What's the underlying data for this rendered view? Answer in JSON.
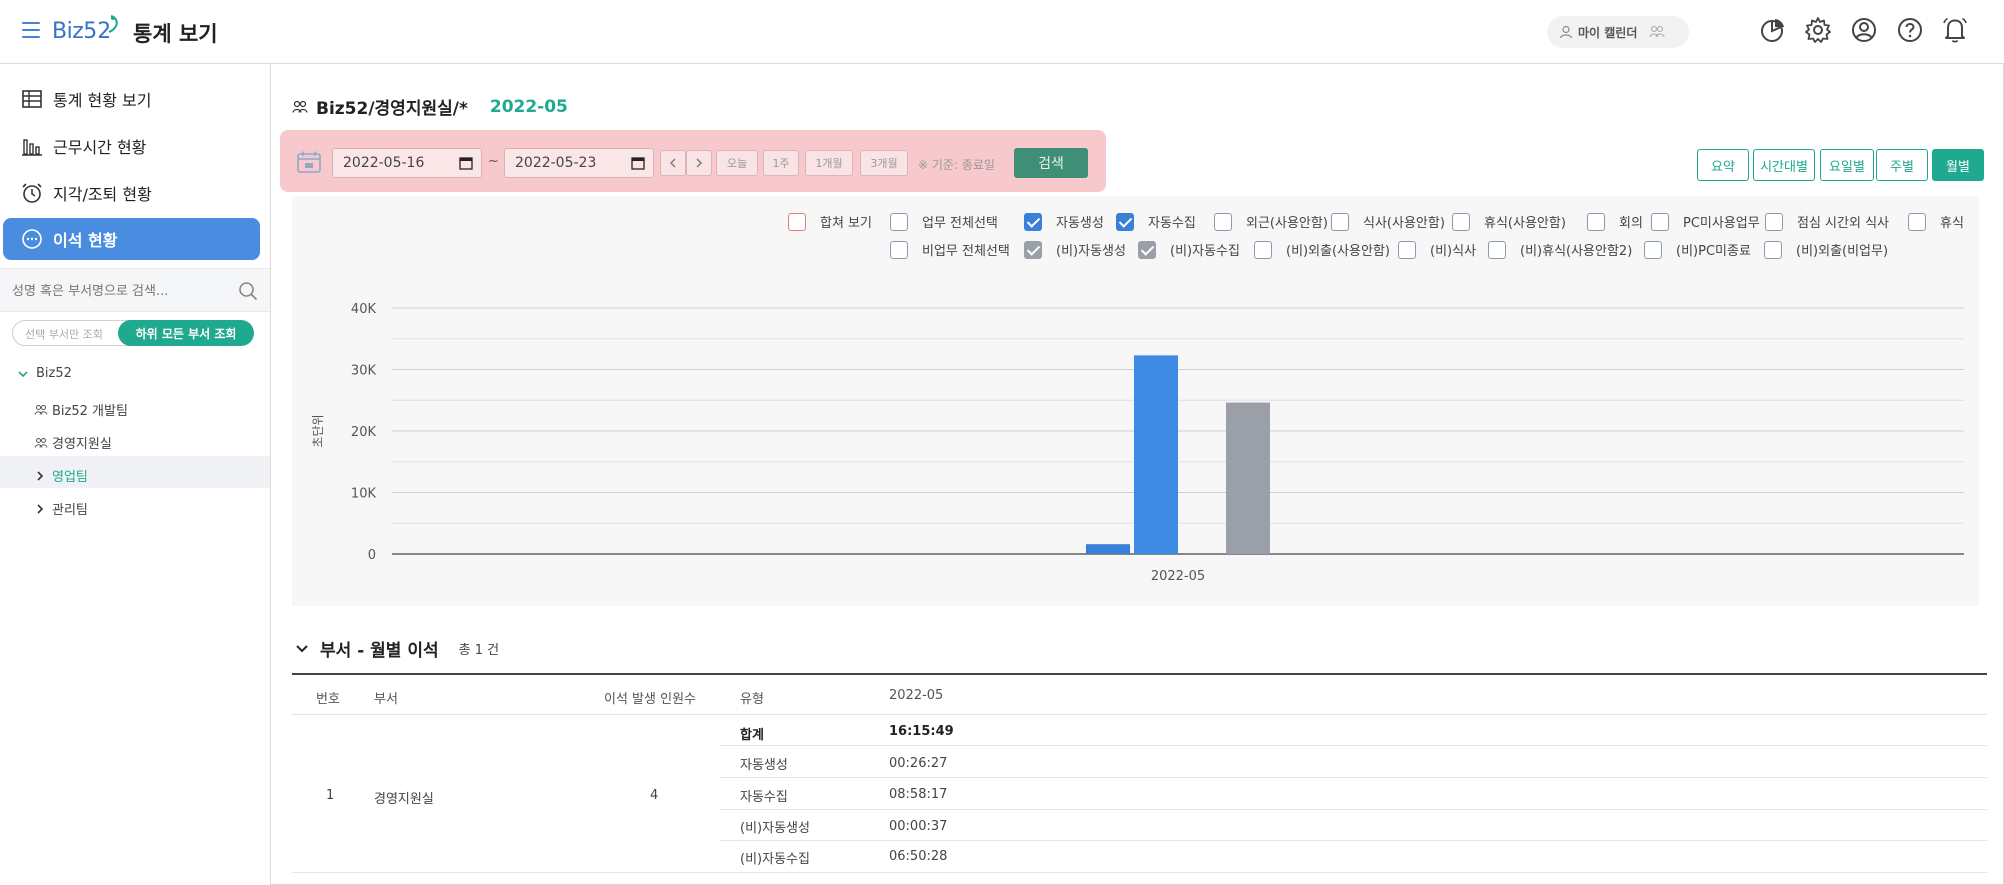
{
  "header": {
    "app_name": "Biz",
    "app_name_num": "52",
    "page_title": "통계 보기",
    "my_calendar_label": "마이 캘린더"
  },
  "sidebar": {
    "menu": [
      {
        "label": "통계 현황 보기",
        "icon": "table-icon"
      },
      {
        "label": "근무시간 현황",
        "icon": "bar-chart-icon"
      },
      {
        "label": "지각/조퇴 현황",
        "icon": "alarm-clock-icon"
      },
      {
        "label": "이석 현황",
        "icon": "more-circle-icon",
        "active": true
      }
    ],
    "search_placeholder": "성명 혹은 부서명으로 검색...",
    "scope_left": "선택 부서만 조회",
    "scope_right": "하위 모든 부서 조회",
    "tree": {
      "root": "Biz52",
      "children": [
        "Biz52 개발팀",
        "경영지원실",
        "영업팀",
        "관리팀"
      ]
    }
  },
  "main": {
    "breadcrumb": "Biz52/경영지원실/*",
    "period": "2022-05",
    "filter": {
      "start_date": "2022-05-16",
      "end_date": "2022-05-23",
      "tilde": "~",
      "quick_buttons": [
        "오늘",
        "1주",
        "1개월",
        "3개월"
      ],
      "basis_note": "※ 기준: 종료일",
      "search_label": "검색"
    },
    "view_buttons": [
      "요약",
      "시간대별",
      "요일별",
      "주별",
      "월별"
    ],
    "checkboxes_row1": [
      {
        "label": "합쳐 보기",
        "state": "red"
      },
      {
        "label": "업무 전체선택",
        "state": "off"
      },
      {
        "label": "자동생성",
        "state": "blue"
      },
      {
        "label": "자동수집",
        "state": "blue"
      },
      {
        "label": "외근(사용안함)",
        "state": "off"
      },
      {
        "label": "식사(사용안함)",
        "state": "off"
      },
      {
        "label": "휴식(사용안함)",
        "state": "off"
      },
      {
        "label": "회의",
        "state": "off"
      },
      {
        "label": "PC미사용업무",
        "state": "off"
      },
      {
        "label": "점심 시간외 식사",
        "state": "off"
      },
      {
        "label": "휴식",
        "state": "off"
      }
    ],
    "checkboxes_row2": [
      {
        "label": "비업무 전체선택",
        "state": "off"
      },
      {
        "label": "(비)자동생성",
        "state": "gray"
      },
      {
        "label": "(비)자동수집",
        "state": "gray"
      },
      {
        "label": "(비)외출(사용안함)",
        "state": "off"
      },
      {
        "label": "(비)식사",
        "state": "off"
      },
      {
        "label": "(비)휴식(사용안함2)",
        "state": "off"
      },
      {
        "label": "(비)PC미종료",
        "state": "off"
      },
      {
        "label": "(비)외출(비업무)",
        "state": "off"
      }
    ]
  },
  "chart_data": {
    "type": "bar",
    "categories": [
      "2022-05"
    ],
    "ylabel": "초단위",
    "ylim": [
      0,
      40000
    ],
    "yticks": [
      "0",
      "10K",
      "20K",
      "30K",
      "40K"
    ],
    "grid": true,
    "series": [
      {
        "name": "자동생성",
        "values": [
          1597
        ],
        "color": "#3a7fd8"
      },
      {
        "name": "자동수집",
        "values": [
          32297
        ],
        "color": "#3f8ae2"
      },
      {
        "name": "(비)자동수집",
        "values": [
          24628
        ],
        "color": "#9b9fa8"
      }
    ]
  },
  "table": {
    "title": "부서 - 월별 이석",
    "count": "총 1 건",
    "headers": [
      "번호",
      "부서",
      "이석 발생 인원수",
      "유형",
      "2022-05"
    ],
    "row": {
      "no": "1",
      "dept": "경영지원실",
      "people": "4",
      "types": [
        {
          "type": "합계",
          "value": "16:15:49"
        },
        {
          "type": "자동생성",
          "value": "00:26:27"
        },
        {
          "type": "자동수집",
          "value": "08:58:17"
        },
        {
          "type": "(비)자동생성",
          "value": "00:00:37"
        },
        {
          "type": "(비)자동수집",
          "value": "06:50:28"
        }
      ]
    }
  },
  "colors": {
    "accent": "#1fa98f",
    "primary_blue": "#4a8de0",
    "highlight_pink": "#f7c9cc"
  }
}
